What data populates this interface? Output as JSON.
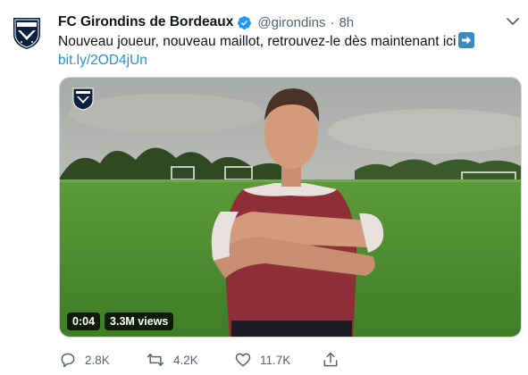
{
  "tweet": {
    "author_name": "FC Girondins de Bordeaux",
    "handle": "@girondins",
    "separator": "·",
    "time": "8h",
    "text": "Nouveau joueur, nouveau maillot, retrouvez-le dès maintenant ici",
    "link": "bit.ly/2OD4jUn",
    "verified": true,
    "icons": [
      "girondins-logo-icon",
      "verified-icon",
      "chevron-down-icon",
      "right-arrow-emoji-icon",
      "reply-icon",
      "retweet-icon",
      "like-icon",
      "share-icon"
    ]
  },
  "video": {
    "duration": "0:04",
    "views": "3.3M views"
  },
  "actions": {
    "replies": "2.8K",
    "retweets": "4.2K",
    "likes": "11.7K"
  },
  "colors": {
    "link": "#1b95e0",
    "verified": "#1d9bf0",
    "secondary_text": "#536471",
    "club_navy": "#0b1f3f"
  }
}
